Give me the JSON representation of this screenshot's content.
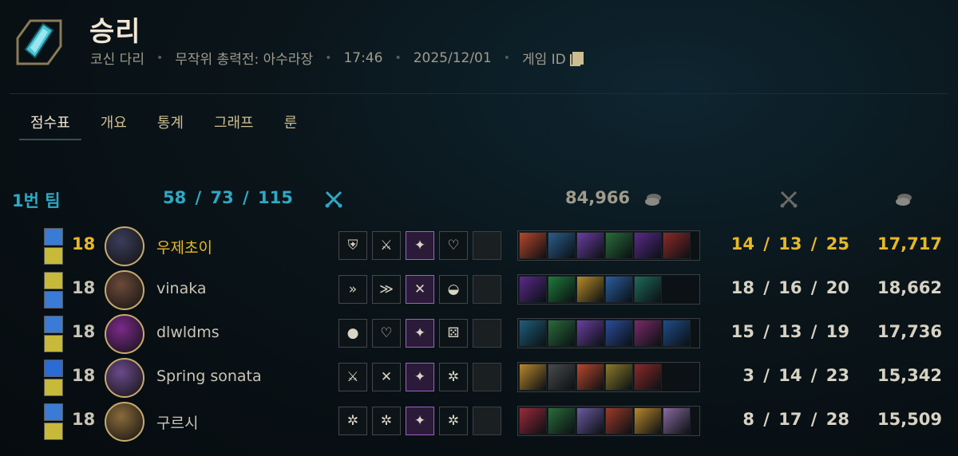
{
  "header": {
    "title": "승리",
    "meta": [
      "코신 다리",
      "무작위 총력전: 아수라장",
      "17:46",
      "2025/12/01"
    ],
    "game_id_label": "게임 ID"
  },
  "tabs": [
    "점수표",
    "개요",
    "통계",
    "그래프",
    "룬"
  ],
  "team": {
    "label": "1번 팀",
    "kda": "58 / 73 / 115",
    "gold": "84,966"
  },
  "players": [
    {
      "level": "18",
      "name": "우제초이",
      "kda": "14 / 13 / 25",
      "gold": "17,717",
      "spells": [
        "#3a7bd5",
        "#c7b93a"
      ],
      "avatar_color": "#3b3d5a",
      "runes": [
        "shield-rune",
        "sword-rune",
        "spark-rune",
        "heart-rune",
        "empty"
      ],
      "items": [
        "#b8472c",
        "#2b5d8a",
        "#6b3fa0",
        "#2a6b3a",
        "#5a2a8a",
        "#8a2a2a"
      ]
    },
    {
      "level": "18",
      "name": "vinaka",
      "kda": "18 / 16 / 20",
      "gold": "18,662",
      "spells": [
        "#c7b93a",
        "#3a7bd5"
      ],
      "avatar_color": "#6b4a3a",
      "runes": [
        "run-rune",
        "dash-rune",
        "blade-rune",
        "bowl-rune",
        "empty"
      ],
      "items": [
        "#5a2a8a",
        "#1f7a3a",
        "#b88a2a",
        "#2a5da0",
        "#1f6a5a",
        "empty"
      ]
    },
    {
      "level": "18",
      "name": "dlwldms",
      "kda": "15 / 13 / 19",
      "gold": "17,736",
      "spells": [
        "#3a7bd5",
        "#c7b93a"
      ],
      "avatar_color": "#7a2a8a",
      "runes": [
        "orb-rune",
        "heart-rune",
        "spark-rune",
        "dice-rune",
        "empty"
      ],
      "items": [
        "#1f5d7a",
        "#2a6b3a",
        "#6b3fa0",
        "#2a4d9a",
        "#7a2a6a",
        "#1f4d8a"
      ]
    },
    {
      "level": "18",
      "name": "Spring sonata",
      "kda": "3 / 14 / 23",
      "gold": "15,342",
      "spells": [
        "#2a6bd5",
        "#c7b93a"
      ],
      "avatar_color": "#6b4a8a",
      "runes": [
        "sword-rune",
        "blade-rune",
        "spark-rune",
        "gear-rune",
        "empty"
      ],
      "items": [
        "#b8872c",
        "#4a4a4a",
        "#b8472c",
        "#8a7a2a",
        "#8a2a2a",
        "empty"
      ]
    },
    {
      "level": "18",
      "name": "구르시",
      "kda": "8 / 17 / 28",
      "gold": "15,509",
      "spells": [
        "#3a7bd5",
        "#c7b93a"
      ],
      "avatar_color": "#8a6a3a",
      "runes": [
        "gear-rune",
        "gear-rune",
        "spark-rune",
        "gear-rune",
        "empty"
      ],
      "items": [
        "#9a2a3a",
        "#2a6b3a",
        "#6b5aa0",
        "#9a3a2a",
        "#b8872c",
        "#8a6aa0"
      ]
    }
  ]
}
